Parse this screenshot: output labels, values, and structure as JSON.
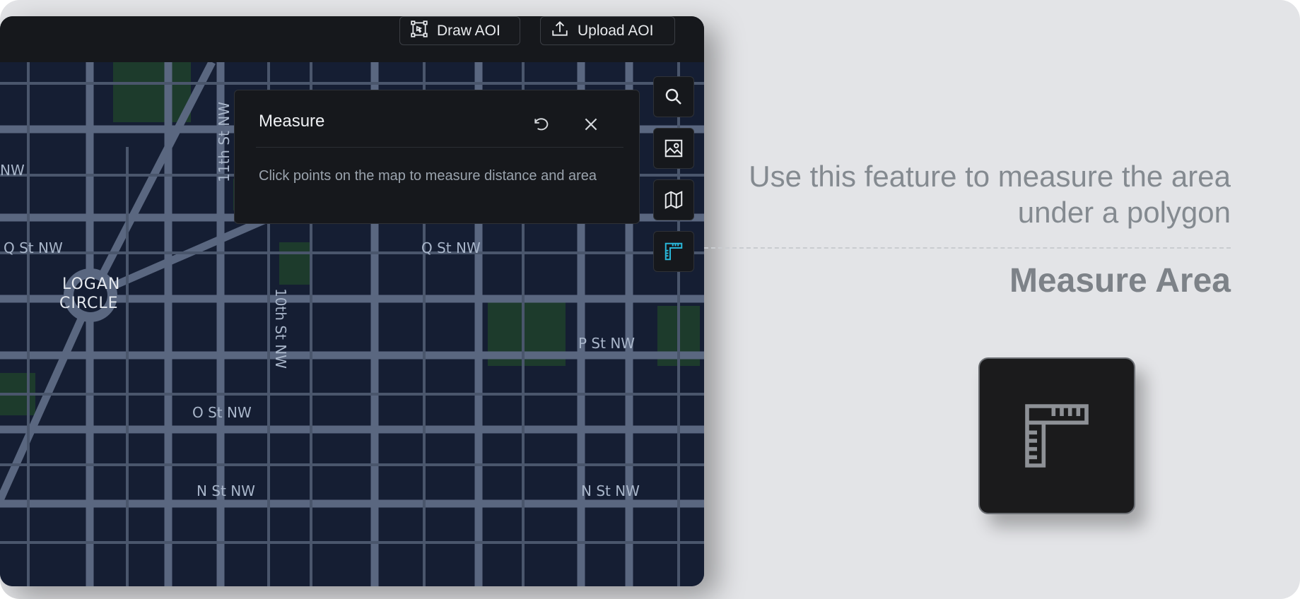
{
  "toolbar": {
    "draw_label": "Draw AOI",
    "upload_label": "Upload AOI"
  },
  "measure_panel": {
    "title": "Measure",
    "description": "Click points on the map to measure distance and area"
  },
  "map_labels": {
    "streets": [
      "Q St NW",
      "Q St NW",
      "P St NW",
      "O St NW",
      "N St NW",
      "N St NW",
      "11th St NW",
      "10th St NW",
      "NW"
    ],
    "place": [
      "LOGAN",
      "CIRCLE"
    ]
  },
  "side_tools": [
    {
      "name": "search",
      "icon": "search-icon"
    },
    {
      "name": "imagery",
      "icon": "image-icon"
    },
    {
      "name": "basemap",
      "icon": "map-icon"
    },
    {
      "name": "measure",
      "icon": "ruler-icon",
      "active": true
    }
  ],
  "feature": {
    "caption": "Use this feature to measure the area under a polygon",
    "title": "Measure Area",
    "icon": "ruler-icon"
  },
  "colors": {
    "accent": "#29b6d8",
    "map_background": "#151e33",
    "road": "#5a6780",
    "park": "#1d3b2c"
  }
}
